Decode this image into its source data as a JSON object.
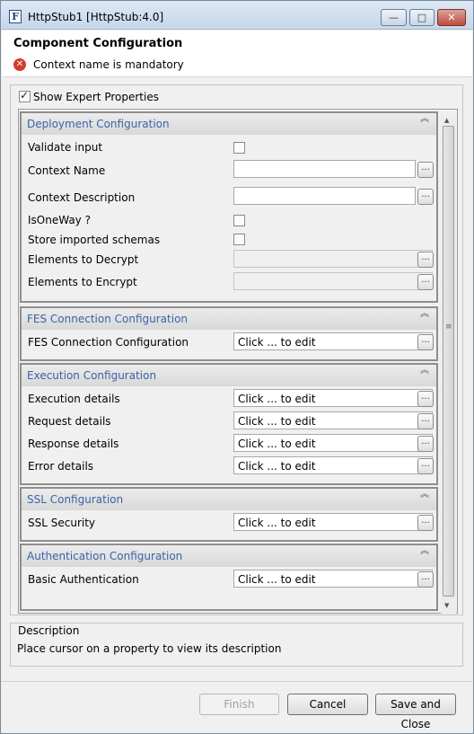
{
  "window": {
    "title": "HttpStub1 [HttpStub:4.0]",
    "app_icon_letter": "F",
    "minimize_glyph": "—",
    "maximize_glyph": "□",
    "close_glyph": "✕"
  },
  "header": {
    "title": "Component Configuration",
    "error_icon": "error-icon",
    "error_message": "Context name is mandatory"
  },
  "options": {
    "show_expert_label": "Show Expert Properties",
    "show_expert_checked": true
  },
  "sections": {
    "deployment": {
      "title": "Deployment Configuration",
      "validate_input": "Validate input",
      "context_name": "Context Name",
      "context_description": "Context Description",
      "is_one_way": "IsOneWay ?",
      "store_imported_schemas": "Store imported schemas",
      "elements_to_decrypt": "Elements to Decrypt",
      "elements_to_encrypt": "Elements to Encrypt"
    },
    "fes": {
      "title": "FES Connection Configuration",
      "fes_connection_configuration": "FES Connection Configuration"
    },
    "execution": {
      "title": "Execution Configuration",
      "execution_details": "Execution details",
      "request_details": "Request details",
      "response_details": "Response details",
      "error_details": "Error details"
    },
    "ssl": {
      "title": "SSL Configuration",
      "ssl_security": "SSL Security"
    },
    "authentication": {
      "title": "Authentication Configuration",
      "basic_authentication": "Basic Authentication"
    }
  },
  "field_values": {
    "click_to_edit": "Click ... to edit",
    "dots": "...",
    "collapse_glyph": "︽"
  },
  "description": {
    "legend": "Description",
    "text": "Place cursor on a property to view its description"
  },
  "buttons": {
    "finish": "Finish",
    "cancel": "Cancel",
    "save_and_close": "Save and Close"
  }
}
